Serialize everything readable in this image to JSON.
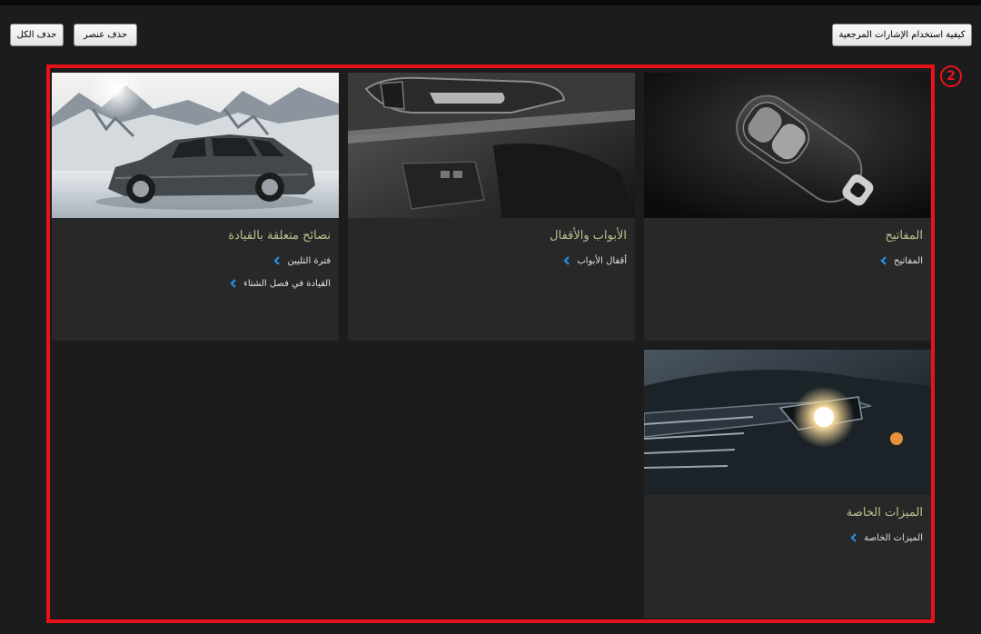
{
  "toolbar": {
    "delete_all_label": "حذف الكل",
    "delete_item_label": "حذف عنصر",
    "howto_label": "كيفية استخدام الإشارات المرجعية"
  },
  "annotation": {
    "marker": "2"
  },
  "cards": [
    {
      "id": "driving",
      "title": "نصائح متعلقة بالقيادة",
      "links": [
        "فترة التليين",
        "القيادة في فصل الشتاء"
      ]
    },
    {
      "id": "doors",
      "title": "الأبواب والأقفال",
      "links": [
        "أقفال الأبواب"
      ]
    },
    {
      "id": "keys",
      "title": "المفاتيح",
      "links": [
        "المفاتيح"
      ]
    },
    {
      "id": "features",
      "title": "الميزات الخاصة",
      "links": [
        "الميزات الخاصة"
      ]
    }
  ],
  "colors": {
    "background": "#1c1c1c",
    "card": "#282828",
    "card_title": "#b9c48e",
    "link_text": "#e2e2e2",
    "chevron": "#2a8fe0",
    "highlight_frame": "#e8121a"
  },
  "icons": {
    "link_arrow": "chevron-left-icon"
  }
}
